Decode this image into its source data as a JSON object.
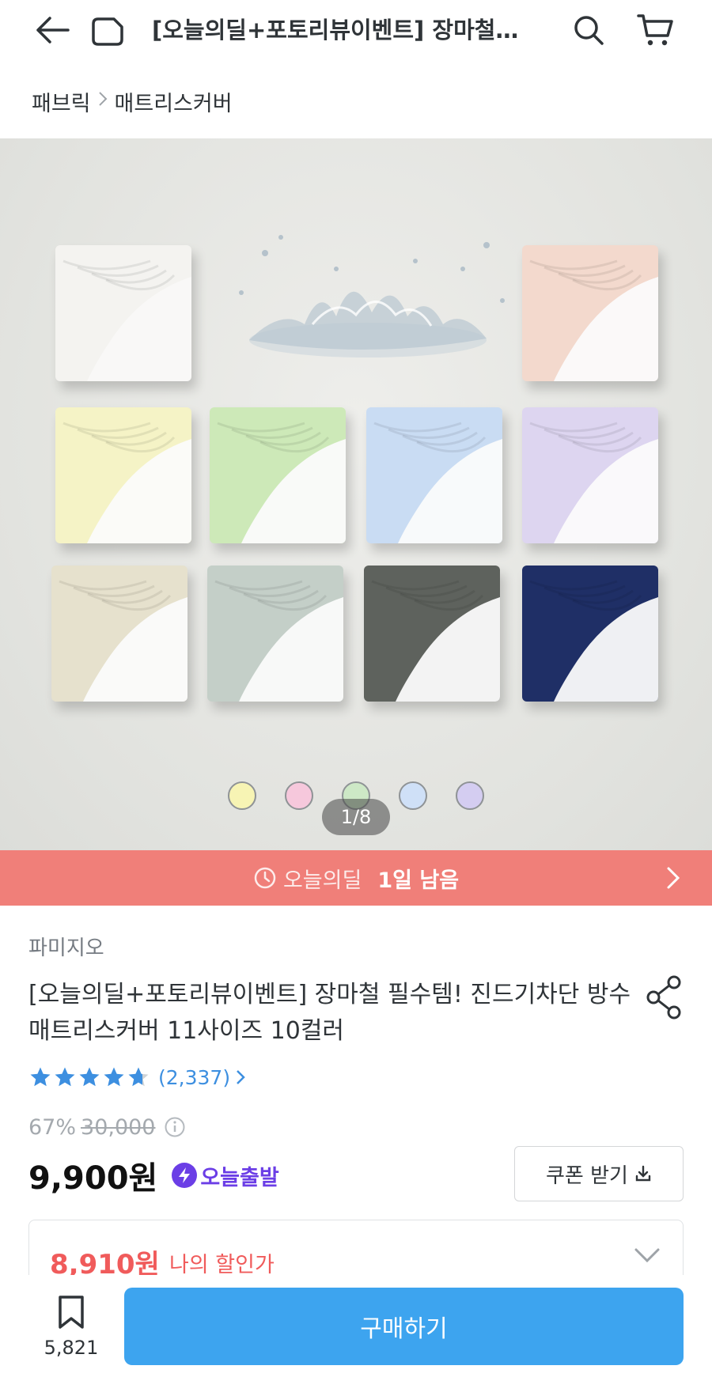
{
  "header": {
    "title": "[오늘의딜+포토리뷰이벤트] 장마철…",
    "back_icon": "arrow-left-icon",
    "home_icon": "home-icon",
    "search_icon": "search-icon",
    "cart_icon": "cart-icon"
  },
  "breadcrumb": {
    "items": [
      "패브릭",
      "매트리스커버"
    ],
    "separator": ">"
  },
  "gallery": {
    "counter": "1/8",
    "swatch_colors": [
      "#f7f4b4",
      "#f6c8dc",
      "#cde8c6",
      "#cfe0f7",
      "#d4cdf1"
    ],
    "sheet_colors": {
      "white": "#f4f3f0",
      "peach": "#f3d9cd",
      "yellow": "#f5f3c6",
      "green": "#cde9b8",
      "blue": "#c9dcf3",
      "lavender": "#ddd5f0",
      "beige": "#e6e1cd",
      "sage": "#c4cfc8",
      "charcoal": "#5e625d",
      "navy": "#1f2f66"
    }
  },
  "deal": {
    "label": "오늘의딜",
    "remaining": "1일 남음",
    "color": "#f07f79"
  },
  "product": {
    "brand": "파미지오",
    "title": "[오늘의딜+포토리뷰이벤트] 장마철 필수템! 진드기차단 방수 매트리스커버 11사이즈 10컬러",
    "rating": 4.7,
    "review_count": "(2,337)",
    "discount_rate": "67%",
    "original_price": "30,000",
    "price": "9,900원",
    "shipping_badge": "오늘출발",
    "coupon_label": "쿠폰 받기",
    "my_discount_price": "8,910원",
    "my_discount_label": "나의 할인가"
  },
  "bottom_bar": {
    "bookmark_count": "5,821",
    "buy_label": "구매하기",
    "buy_color": "#3da4ef"
  }
}
